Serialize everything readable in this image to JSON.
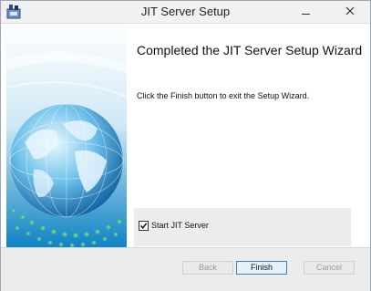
{
  "window": {
    "title": "JIT Server Setup",
    "icon": "installer-icon",
    "controls": {
      "minimize": "minimize-icon",
      "close": "close-icon"
    }
  },
  "wizard": {
    "heading": "Completed the JIT Server Setup Wizard",
    "description": "Click the Finish button to exit the Setup Wizard.",
    "side_image": "globe-graphic"
  },
  "options": {
    "start_label": "Start JIT Server",
    "start_checked": true
  },
  "buttons": {
    "back": "Back",
    "finish": "Finish",
    "cancel": "Cancel"
  },
  "colors": {
    "accent": "#3c7fb1",
    "panel": "#ececec"
  }
}
